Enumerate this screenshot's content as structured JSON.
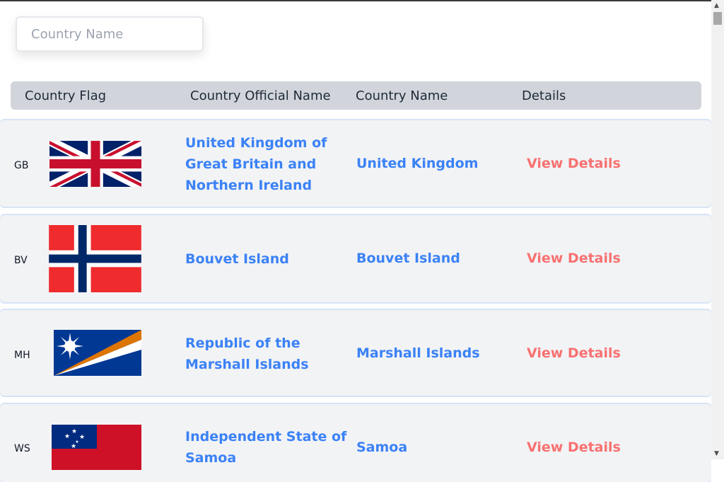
{
  "search": {
    "placeholder": "Country Name",
    "value": ""
  },
  "table": {
    "headers": {
      "flag": "Country Flag",
      "official": "Country Official Name",
      "name": "Country Name",
      "details": "Details"
    },
    "rows": [
      {
        "code": "GB",
        "flag_icon": "uk-flag-icon",
        "official_name": "United Kingdom of Great Britain and Northern Ireland",
        "name": "United Kingdom",
        "details_label": "View Details"
      },
      {
        "code": "BV",
        "flag_icon": "norway-flag-icon",
        "official_name": "Bouvet Island",
        "name": "Bouvet Island",
        "details_label": "View Details"
      },
      {
        "code": "MH",
        "flag_icon": "marshall-islands-flag-icon",
        "official_name": "Republic of the Marshall Islands",
        "name": "Marshall Islands",
        "details_label": "View Details"
      },
      {
        "code": "WS",
        "flag_icon": "samoa-flag-icon",
        "official_name": "Independent State of Samoa",
        "name": "Samoa",
        "details_label": "View Details"
      }
    ]
  },
  "colors": {
    "link_blue": "#3b82f6",
    "details_red": "#f87171",
    "header_bg": "#d1d5db",
    "row_bg": "#f2f3f5"
  }
}
